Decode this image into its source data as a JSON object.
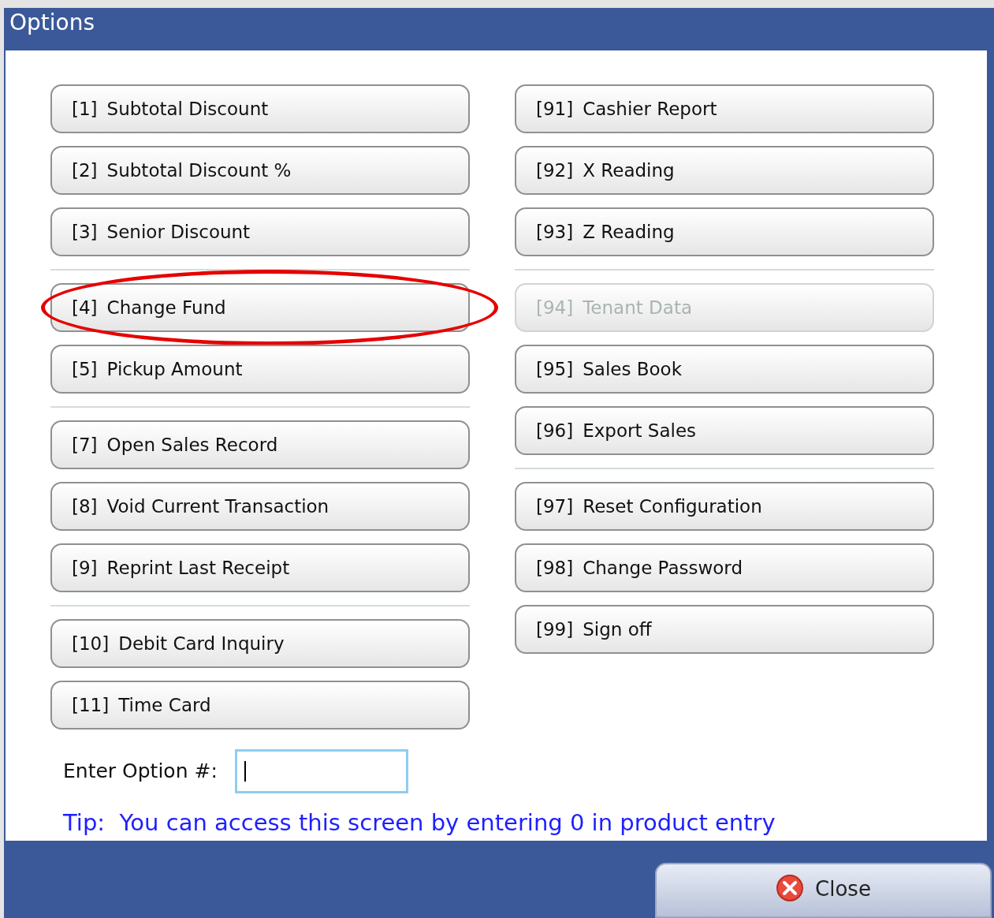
{
  "window": {
    "title": "Options"
  },
  "columns": [
    [
      [
        {
          "number": "[1]",
          "label": "Subtotal Discount",
          "disabled": false,
          "circled": false
        },
        {
          "number": "[2]",
          "label": "Subtotal Discount %",
          "disabled": false,
          "circled": false
        },
        {
          "number": "[3]",
          "label": "Senior Discount",
          "disabled": false,
          "circled": false
        }
      ],
      [
        {
          "number": "[4]",
          "label": "Change Fund",
          "disabled": false,
          "circled": true
        },
        {
          "number": "[5]",
          "label": "Pickup Amount",
          "disabled": false,
          "circled": false
        }
      ],
      [
        {
          "number": "[7]",
          "label": "Open Sales Record",
          "disabled": false,
          "circled": false
        },
        {
          "number": "[8]",
          "label": "Void Current Transaction",
          "disabled": false,
          "circled": false
        },
        {
          "number": "[9]",
          "label": "Reprint Last Receipt",
          "disabled": false,
          "circled": false
        }
      ],
      [
        {
          "number": "[10]",
          "label": "Debit Card Inquiry",
          "disabled": false,
          "circled": false
        },
        {
          "number": "[11]",
          "label": "Time Card",
          "disabled": false,
          "circled": false
        }
      ]
    ],
    [
      [
        {
          "number": "[91]",
          "label": "Cashier Report",
          "disabled": false,
          "circled": false
        },
        {
          "number": "[92]",
          "label": "X Reading",
          "disabled": false,
          "circled": false
        },
        {
          "number": "[93]",
          "label": "Z Reading",
          "disabled": false,
          "circled": false
        }
      ],
      [
        {
          "number": "[94]",
          "label": "Tenant Data",
          "disabled": true,
          "circled": false
        },
        {
          "number": "[95]",
          "label": "Sales Book",
          "disabled": false,
          "circled": false
        },
        {
          "number": "[96]",
          "label": "Export Sales",
          "disabled": false,
          "circled": false
        }
      ],
      [
        {
          "number": "[97]",
          "label": "Reset Configuration",
          "disabled": false,
          "circled": false
        },
        {
          "number": "[98]",
          "label": "Change Password",
          "disabled": false,
          "circled": false
        },
        {
          "number": "[99]",
          "label": "Sign off",
          "disabled": false,
          "circled": false
        }
      ]
    ]
  ],
  "option_field": {
    "label": "Enter Option #:"
  },
  "tip": "Tip:  You can access this screen by entering 0 in product entry",
  "close_button": {
    "label": "Close"
  }
}
